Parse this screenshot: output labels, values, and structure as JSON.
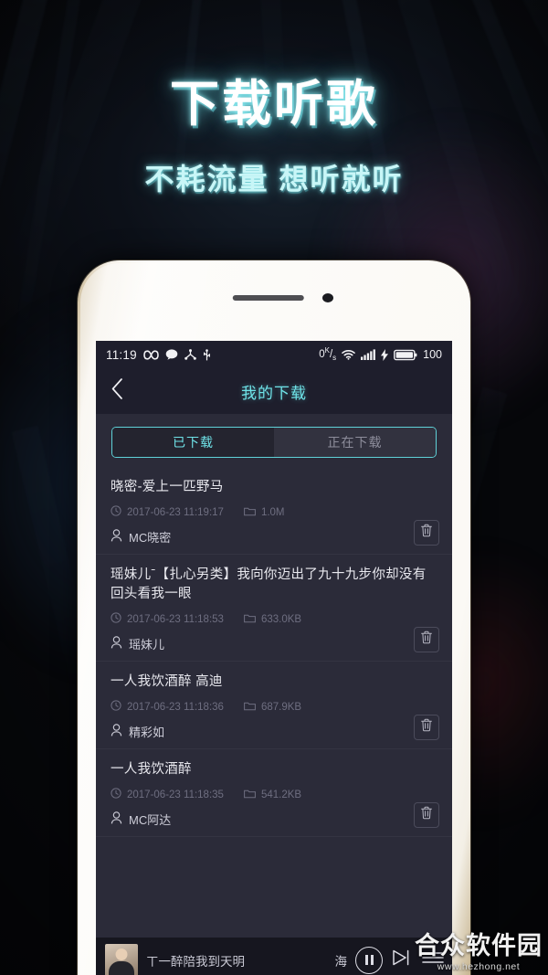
{
  "promo": {
    "title": "下载听歌",
    "subtitle": "不耗流量 想听就听"
  },
  "colors": {
    "accent_cyan": "#6fe3e8",
    "screen_bg": "#2b2b39",
    "bar_bg": "#1e1e2c",
    "player_bg": "#16161f",
    "muted_text": "#6e6e80"
  },
  "status_bar": {
    "time": "11:19",
    "left_icons": [
      "infinity-icon",
      "message-icon",
      "share-icon",
      "usb-icon"
    ],
    "data_rate": "0",
    "data_rate_unit_top": "K",
    "data_rate_unit_bottom": "s",
    "right_icons": [
      "wifi-icon",
      "signal-icon",
      "charging-bolt-icon",
      "battery-icon"
    ],
    "battery_level": "100"
  },
  "navbar": {
    "back_icon": "chevron-left-icon",
    "title": "我的下载"
  },
  "tabs": [
    {
      "label": "已下载",
      "active": true
    },
    {
      "label": "正在下载",
      "active": false
    }
  ],
  "downloads": [
    {
      "title": "晓密-爱上一匹野马",
      "date": "2017-06-23 11:19:17",
      "size": "1.0M",
      "artist": "MC晓密",
      "delete_label": "删除"
    },
    {
      "title": "瑶妹儿ˉ【扎心另类】我向你迈出了九十九步你却没有回头看我一眼",
      "date": "2017-06-23 11:18:53",
      "size": "633.0KB",
      "artist": "瑶妹儿",
      "delete_label": "删除"
    },
    {
      "title": "一人我饮酒醉 高迪",
      "date": "2017-06-23 11:18:36",
      "size": "687.9KB",
      "artist": "精彩如",
      "delete_label": "删除"
    },
    {
      "title": "一人我饮酒醉",
      "date": "2017-06-23 11:18:35",
      "size": "541.2KB",
      "artist": "MC阿达",
      "delete_label": "删除"
    }
  ],
  "player": {
    "track_title": "ㄒ一醉陪我到天明",
    "extra_text": "海",
    "pause_icon": "pause-icon",
    "next_icon": "next-track-icon",
    "playlist_icon": "playlist-icon"
  },
  "watermark": {
    "name": "合众软件园",
    "url": "www.hezhong.net"
  }
}
